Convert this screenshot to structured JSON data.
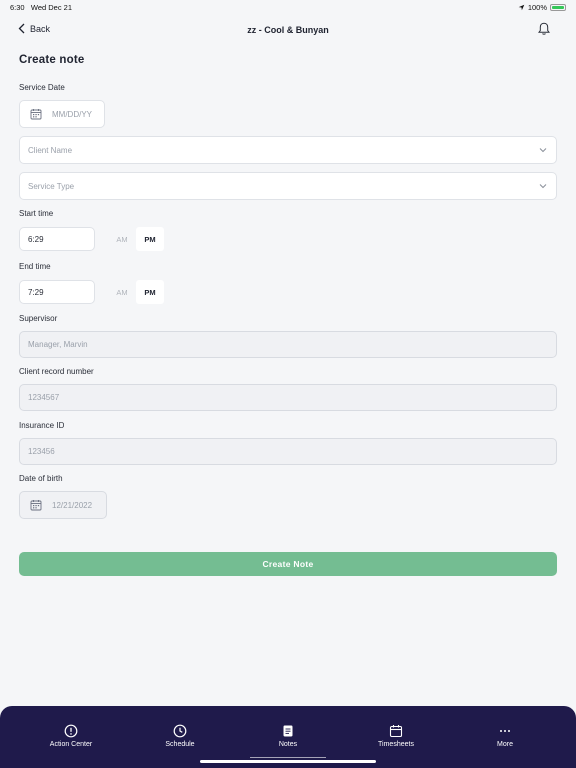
{
  "status_bar": {
    "time": "6:30",
    "date": "Wed Dec 21",
    "battery": "100%"
  },
  "nav": {
    "back_label": "Back",
    "title": "zz - Cool & Bunyan"
  },
  "page_title": "Create note",
  "form": {
    "service_date": {
      "label": "Service Date",
      "placeholder": "MM/DD/YY"
    },
    "client_name": {
      "placeholder": "Client Name"
    },
    "service_type": {
      "placeholder": "Service Type"
    },
    "start_time": {
      "label": "Start time",
      "value": "6:29",
      "am": "AM",
      "pm": "PM",
      "selected": "PM"
    },
    "end_time": {
      "label": "End time",
      "value": "7:29",
      "am": "AM",
      "pm": "PM",
      "selected": "PM"
    },
    "supervisor": {
      "label": "Supervisor",
      "value": "Manager, Marvin"
    },
    "client_record_number": {
      "label": "Client record number",
      "value": "1234567"
    },
    "insurance_id": {
      "label": "Insurance ID",
      "value": "123456"
    },
    "date_of_birth": {
      "label": "Date of birth",
      "value": "12/21/2022"
    },
    "submit_label": "Create Note"
  },
  "tabs": [
    {
      "label": "Action Center",
      "icon": "alert-circle-icon"
    },
    {
      "label": "Schedule",
      "icon": "clock-icon"
    },
    {
      "label": "Notes",
      "icon": "note-icon",
      "active": true
    },
    {
      "label": "Timesheets",
      "icon": "calendar-icon"
    },
    {
      "label": "More",
      "icon": "more-icon"
    }
  ],
  "colors": {
    "accent_green": "#74bd92",
    "tabbar_bg": "#1f1a4b",
    "page_bg": "#f5f6f8"
  }
}
